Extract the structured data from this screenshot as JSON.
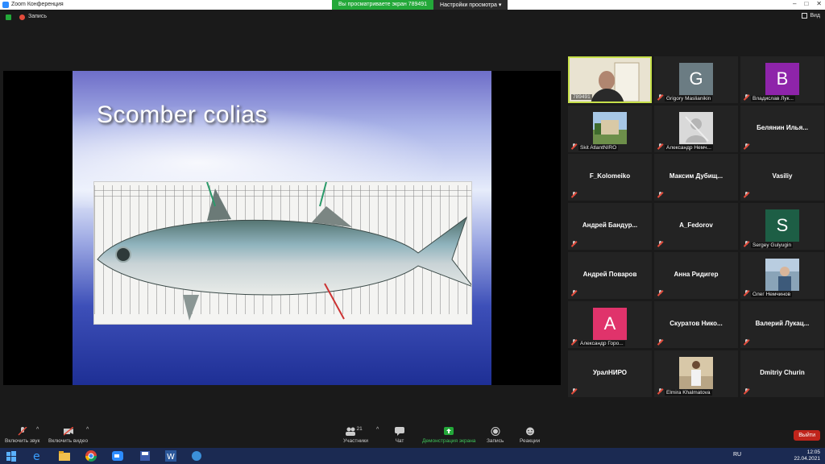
{
  "window": {
    "title": "Zoom Конференция"
  },
  "screen_bar": {
    "viewing": "Вы просматриваете экран 789491",
    "settings": "Настройки просмотра"
  },
  "recording": {
    "label": "Запись"
  },
  "view": {
    "label": "Вид"
  },
  "slide": {
    "title": "Scomber colias"
  },
  "self_video": {
    "label": "789491"
  },
  "participants": [
    {
      "name": "Grigory Maslianikin",
      "initial": "G",
      "color": "#6b7c83"
    },
    {
      "name": "Владислав Лук...",
      "initial": "B",
      "color": "#8e24aa"
    },
    {
      "name": "Skit AtlantNIRO"
    },
    {
      "name": "Александр Немч..."
    },
    {
      "name": "Белянин Илья..."
    },
    {
      "name": "F_Kolomeiko"
    },
    {
      "name": "Максим Дубищ..."
    },
    {
      "name": "Vasiliy"
    },
    {
      "name": "Андрей Бандур..."
    },
    {
      "name": "A_Fedorov"
    },
    {
      "name": "Sergey Gulyugin",
      "initial": "S",
      "color": "#1d5e45"
    },
    {
      "name": "Андрей Поваров"
    },
    {
      "name": "Анна Ридигер"
    },
    {
      "name": "Олег Немчинов"
    },
    {
      "name": "Александр Горо...",
      "initial": "A",
      "color": "#e0336b"
    },
    {
      "name": "Скуратов Нико..."
    },
    {
      "name": "Валерий Лукац..."
    },
    {
      "name": "УралНИРО"
    },
    {
      "name": "Elmira Khalmatova"
    },
    {
      "name": "Dmitriy Churin"
    }
  ],
  "toolbar": {
    "audio": "Включить звук",
    "video": "Включить видео",
    "participants": "Участники",
    "participants_count": "21",
    "chat": "Чат",
    "share": "Демонстрация экрана",
    "record": "Запись",
    "reactions": "Реакции",
    "leave": "Выйти"
  },
  "taskbar": {
    "lang": "RU",
    "time": "12:05",
    "date": "22.04.2021"
  },
  "colors": {
    "accent_green": "#23a839",
    "active_border": "#c7e04a",
    "leave_red": "#c0241b"
  }
}
